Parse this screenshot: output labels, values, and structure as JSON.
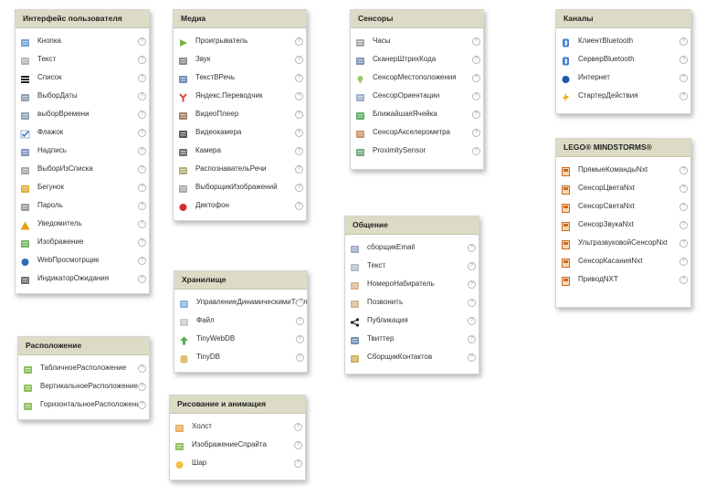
{
  "ui": {
    "title": "Интерфейс пользователя",
    "items": [
      {
        "label": "Кнопка",
        "icon": "button-icon",
        "color": "#5a8fd0"
      },
      {
        "label": "Текст",
        "icon": "text-icon",
        "color": "#a8a8a8"
      },
      {
        "label": "Список",
        "icon": "list-icon",
        "color": "#222222"
      },
      {
        "label": "ВыборДаты",
        "icon": "calendar-icon",
        "color": "#7a8ea0"
      },
      {
        "label": "выборВремени",
        "icon": "clock-icon",
        "color": "#7a8ea0"
      },
      {
        "label": "Флажок",
        "icon": "checkbox-icon",
        "color": "#3b6fc4"
      },
      {
        "label": "Надпись",
        "icon": "label-icon",
        "color": "#6b82b0"
      },
      {
        "label": "ВыборИзСписка",
        "icon": "listpicker-icon",
        "color": "#9a9a9a"
      },
      {
        "label": "Бегунок",
        "icon": "slider-icon",
        "color": "#d4a017"
      },
      {
        "label": "Пароль",
        "icon": "password-icon",
        "color": "#888888"
      },
      {
        "label": "Уведомитель",
        "icon": "warning-icon",
        "color": "#e0a010"
      },
      {
        "label": "Изображение",
        "icon": "image-icon",
        "color": "#5aa845"
      },
      {
        "label": "WebПросмотрщик",
        "icon": "globe-icon",
        "color": "#2e6db5"
      },
      {
        "label": "ИндикаторОжидания",
        "icon": "spinner-icon",
        "color": "#555555"
      }
    ]
  },
  "media": {
    "title": "Медиа",
    "items": [
      {
        "label": "Проигрыватель",
        "icon": "play-icon",
        "color": "#7cb342"
      },
      {
        "label": "Звук",
        "icon": "speaker-icon",
        "color": "#777777"
      },
      {
        "label": "ТекстВРечь",
        "icon": "text-to-speech-icon",
        "color": "#5677a8"
      },
      {
        "label": "Яндекс.Переводчик",
        "icon": "yandex-icon",
        "color": "#e53935"
      },
      {
        "label": "ВидеоПлеер",
        "icon": "film-icon",
        "color": "#8d6e48"
      },
      {
        "label": "Видеокамера",
        "icon": "video-camera-icon",
        "color": "#3a3a3a"
      },
      {
        "label": "Камера",
        "icon": "camera-icon",
        "color": "#555555"
      },
      {
        "label": "РаспознавательРечи",
        "icon": "microphone-icon",
        "color": "#a0a060"
      },
      {
        "label": "ВыборщикИзображений",
        "icon": "image-picker-icon",
        "color": "#9a9a9a"
      },
      {
        "label": "Диктофон",
        "icon": "record-icon",
        "color": "#d32f2f"
      }
    ]
  },
  "sensors": {
    "title": "Сенсоры",
    "items": [
      {
        "label": "Часы",
        "icon": "timer-icon",
        "color": "#999999"
      },
      {
        "label": "СканерШтрихКода",
        "icon": "barcode-icon",
        "color": "#6a7fa8"
      },
      {
        "label": "СенсорМестоположения",
        "icon": "location-icon",
        "color": "#9ccc65"
      },
      {
        "label": "СенсорОриентации",
        "icon": "orientation-icon",
        "color": "#8ca0c0"
      },
      {
        "label": "БлижайшаяЯчейка",
        "icon": "proximity-icon",
        "color": "#43a047"
      },
      {
        "label": "СенсорАкселерометра",
        "icon": "accelerometer-icon",
        "color": "#c08050"
      },
      {
        "label": "ProximitySensor",
        "icon": "proximity-sensor-icon",
        "color": "#5a9a6a"
      }
    ]
  },
  "channels": {
    "title": "Каналы",
    "items": [
      {
        "label": "КлиентBluetooth",
        "icon": "bluetooth-icon",
        "color": "#3f7fd0"
      },
      {
        "label": "СерверBluetooth",
        "icon": "bluetooth-icon",
        "color": "#3f7fd0"
      },
      {
        "label": "Интернет",
        "icon": "web-icon",
        "color": "#1e5aa8"
      },
      {
        "label": "СтартерДействия",
        "icon": "lightning-icon",
        "color": "#f2b01e"
      }
    ]
  },
  "lego": {
    "title": "LEGO® MINDSTORMS®",
    "items": [
      {
        "label": "ПрямыеКомандыNxt",
        "icon": "nxt-brick-icon",
        "color": "#d06a20"
      },
      {
        "label": "СенсорЦветаNxt",
        "icon": "nxt-brick-icon",
        "color": "#d06a20"
      },
      {
        "label": "СенсорСветаNxt",
        "icon": "nxt-brick-icon",
        "color": "#d06a20"
      },
      {
        "label": "СенсорЗвукаNxt",
        "icon": "nxt-brick-icon",
        "color": "#d06a20"
      },
      {
        "label": "УльтразвуковойСенсорNxt",
        "icon": "nxt-brick-icon",
        "color": "#d06a20"
      },
      {
        "label": "СенсорКасанияNxt",
        "icon": "nxt-brick-icon",
        "color": "#d06a20"
      },
      {
        "label": "ПриводNXT",
        "icon": "nxt-brick-icon",
        "color": "#d06a20"
      }
    ]
  },
  "social": {
    "title": "Общение",
    "items": [
      {
        "label": "сборщикEmail",
        "icon": "email-picker-icon",
        "color": "#8c9bb8"
      },
      {
        "label": "Текст",
        "icon": "sms-icon",
        "color": "#a8b0bc"
      },
      {
        "label": "НомероНабиратель",
        "icon": "phone-dialer-icon",
        "color": "#d0a880"
      },
      {
        "label": "Позвонить",
        "icon": "phone-call-icon",
        "color": "#d0a880"
      },
      {
        "label": "Публикация",
        "icon": "share-icon",
        "color": "#222222"
      },
      {
        "label": "Твиттер",
        "icon": "twitter-icon",
        "color": "#5d7fa8"
      },
      {
        "label": "СборщикКонтактов",
        "icon": "contact-picker-icon",
        "color": "#c8a040"
      }
    ]
  },
  "storage": {
    "title": "Хранилище",
    "items": [
      {
        "label": "УправлениеДинамическимиТабл",
        "icon": "cloud-table-icon",
        "color": "#6fa8dc"
      },
      {
        "label": "Файл",
        "icon": "file-icon",
        "color": "#c0c0c0"
      },
      {
        "label": "TinyWebDB",
        "icon": "upload-arrow-icon",
        "color": "#4caf50"
      },
      {
        "label": "TinyDB",
        "icon": "database-icon",
        "color": "#e0c070"
      }
    ]
  },
  "layout": {
    "title": "Расположение",
    "items": [
      {
        "label": "ТабличноеРасположение",
        "icon": "table-layout-icon",
        "color": "#7cb342"
      },
      {
        "label": "ВертикальноеРасположение",
        "icon": "vertical-layout-icon",
        "color": "#7cb342"
      },
      {
        "label": "ГоризонтальноеРасположение",
        "icon": "horizontal-layout-icon",
        "color": "#7cb342"
      }
    ]
  },
  "drawing": {
    "title": "Рисование и анимация",
    "items": [
      {
        "label": "Холст",
        "icon": "canvas-icon",
        "color": "#e0a040"
      },
      {
        "label": "ИзображениеСпрайта",
        "icon": "sprite-icon",
        "color": "#7cb342"
      },
      {
        "label": "Шар",
        "icon": "ball-icon",
        "color": "#f0c040"
      }
    ]
  },
  "help_glyph": "?"
}
